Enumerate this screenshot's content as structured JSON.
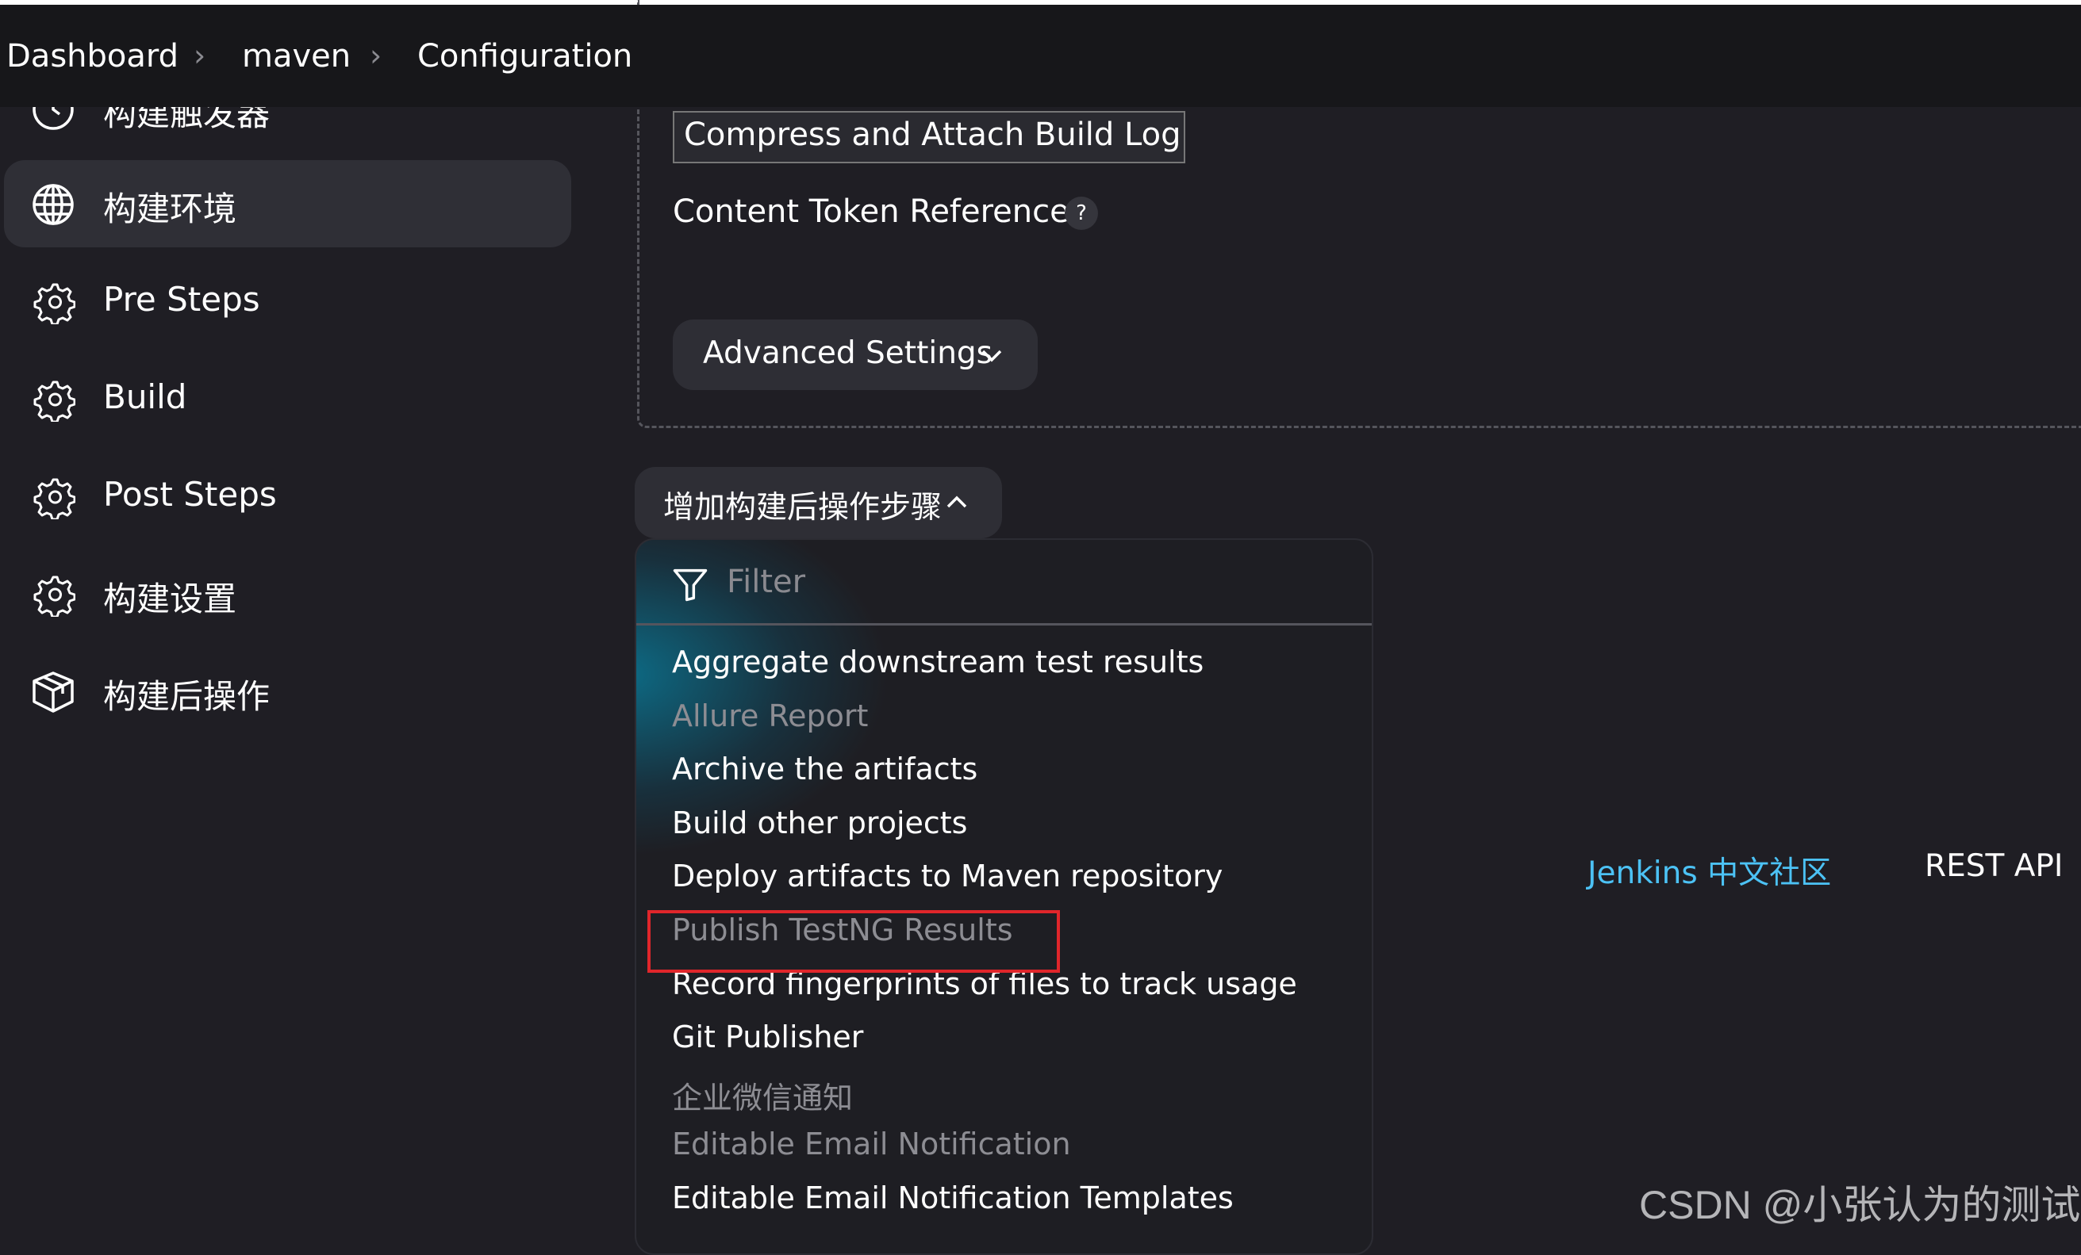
{
  "breadcrumb": [
    {
      "label": "Dashboard"
    },
    {
      "label": "maven"
    },
    {
      "label": "Configuration"
    }
  ],
  "sidebar": {
    "items": [
      {
        "label": "构建触发器",
        "icon": "clock-icon"
      },
      {
        "label": "构建环境",
        "icon": "globe-icon",
        "active": true
      },
      {
        "label": "Pre Steps",
        "icon": "gear-icon"
      },
      {
        "label": "Build",
        "icon": "gear-icon"
      },
      {
        "label": "Post Steps",
        "icon": "gear-icon"
      },
      {
        "label": "构建设置",
        "icon": "gear-icon"
      },
      {
        "label": "构建后操作",
        "icon": "package-icon"
      }
    ]
  },
  "main": {
    "select_value": "Compress and Attach Build Log",
    "content_token_label": "Content Token Reference",
    "help": "?",
    "advanced_label": "Advanced Settings",
    "add_post_build_label": "增加构建后操作步骤",
    "filter_placeholder": "Filter",
    "options": [
      {
        "label": "Aggregate downstream test results",
        "disabled": false
      },
      {
        "label": "Allure Report",
        "disabled": true
      },
      {
        "label": "Archive the artifacts",
        "disabled": false
      },
      {
        "label": "Build other projects",
        "disabled": false
      },
      {
        "label": "Deploy artifacts to Maven repository",
        "disabled": false
      },
      {
        "label": "Publish TestNG Results",
        "disabled": true,
        "highlighted": true
      },
      {
        "label": "Record fingerprints of files to track usage",
        "disabled": false
      },
      {
        "label": "Git Publisher",
        "disabled": false
      },
      {
        "label": "企业微信通知",
        "disabled": true
      },
      {
        "label": "Editable Email Notification",
        "disabled": true
      },
      {
        "label": "Editable Email Notification Templates",
        "disabled": false
      }
    ]
  },
  "footer": {
    "community": "Jenkins 中文社区",
    "rest_api": "REST API"
  },
  "watermark": "CSDN @小张认为的测试",
  "colors": {
    "background": "#1f1e24",
    "link": "#4cc2f5",
    "highlight_box": "#e0262b"
  }
}
